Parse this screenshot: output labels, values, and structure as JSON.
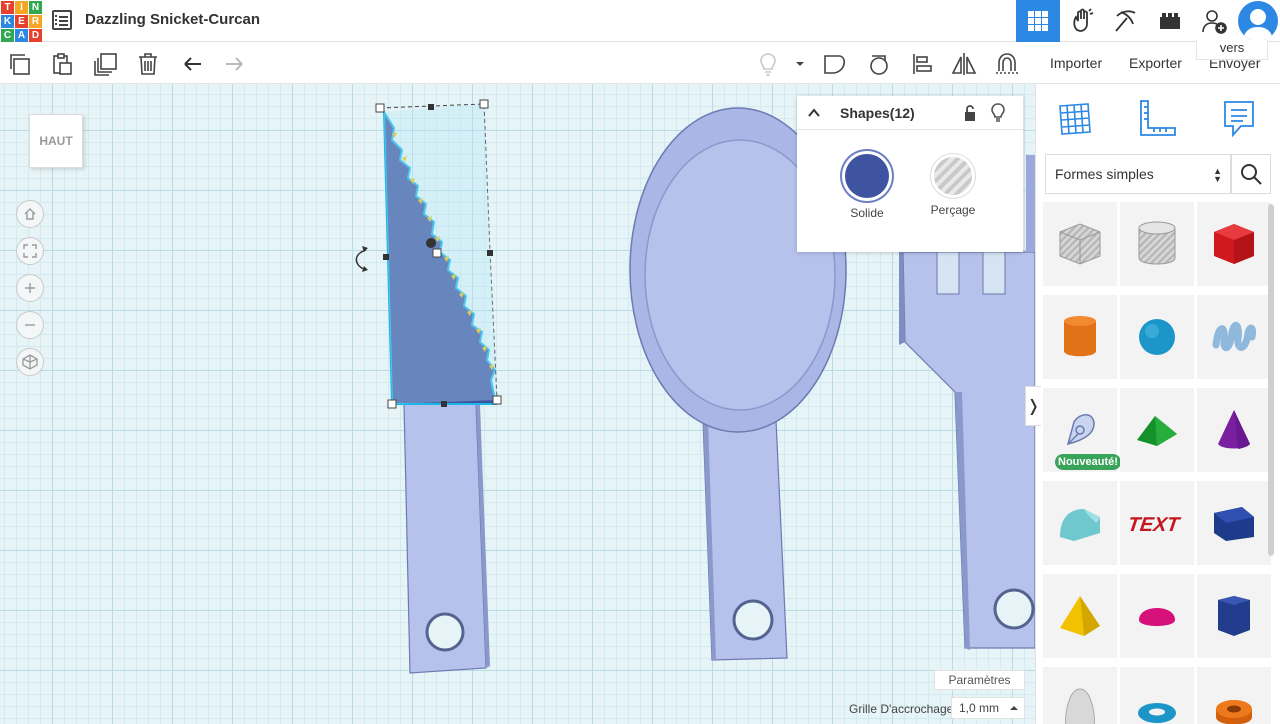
{
  "app": {
    "logo_letters": [
      "T",
      "I",
      "N",
      "K",
      "E",
      "R",
      "C",
      "A",
      "D"
    ],
    "logo_colors": [
      "#e5412d",
      "#f5a623",
      "#33a852",
      "#2d88e4",
      "#e5412d",
      "#f5a623",
      "#33a852",
      "#2d88e4",
      "#e5412d"
    ],
    "project_title": "Dazzling Snicket-Curcan"
  },
  "topbar": {
    "icons": [
      "3d-design-grid-icon",
      "hand-wave-icon",
      "pickaxe-icon",
      "bricks-icon",
      "add-user-icon",
      "user-avatar-icon"
    ]
  },
  "toolbar": {
    "import_label": "Importer",
    "export_label": "Exporter",
    "send_label": "Envoyer",
    "send_label_2": "vers"
  },
  "workplane": {
    "view_label": "HAUT",
    "accent_color": "#2d88e4",
    "shape_color": "#b6c2ec",
    "selected_color": "#3f54a0"
  },
  "shapes_panel": {
    "title": "Shapes(12)",
    "solid_label": "Solide",
    "hole_label": "Perçage",
    "solid_color": "#3f54a0"
  },
  "bottom": {
    "params_label": "Paramètres",
    "grid_label": "Grille D'accrochage",
    "grid_value": "1,0 mm"
  },
  "library": {
    "category": "Formes simples",
    "new_badge": "Nouveauté!",
    "shapes": [
      "box-hole",
      "cylinder-hole",
      "box",
      "cylinder",
      "sphere",
      "scribble",
      "shape-generator",
      "roof",
      "cone",
      "round-roof",
      "text",
      "wedge",
      "pyramid",
      "half-sphere",
      "polygon",
      "paraboloid",
      "torus",
      "tube"
    ]
  }
}
